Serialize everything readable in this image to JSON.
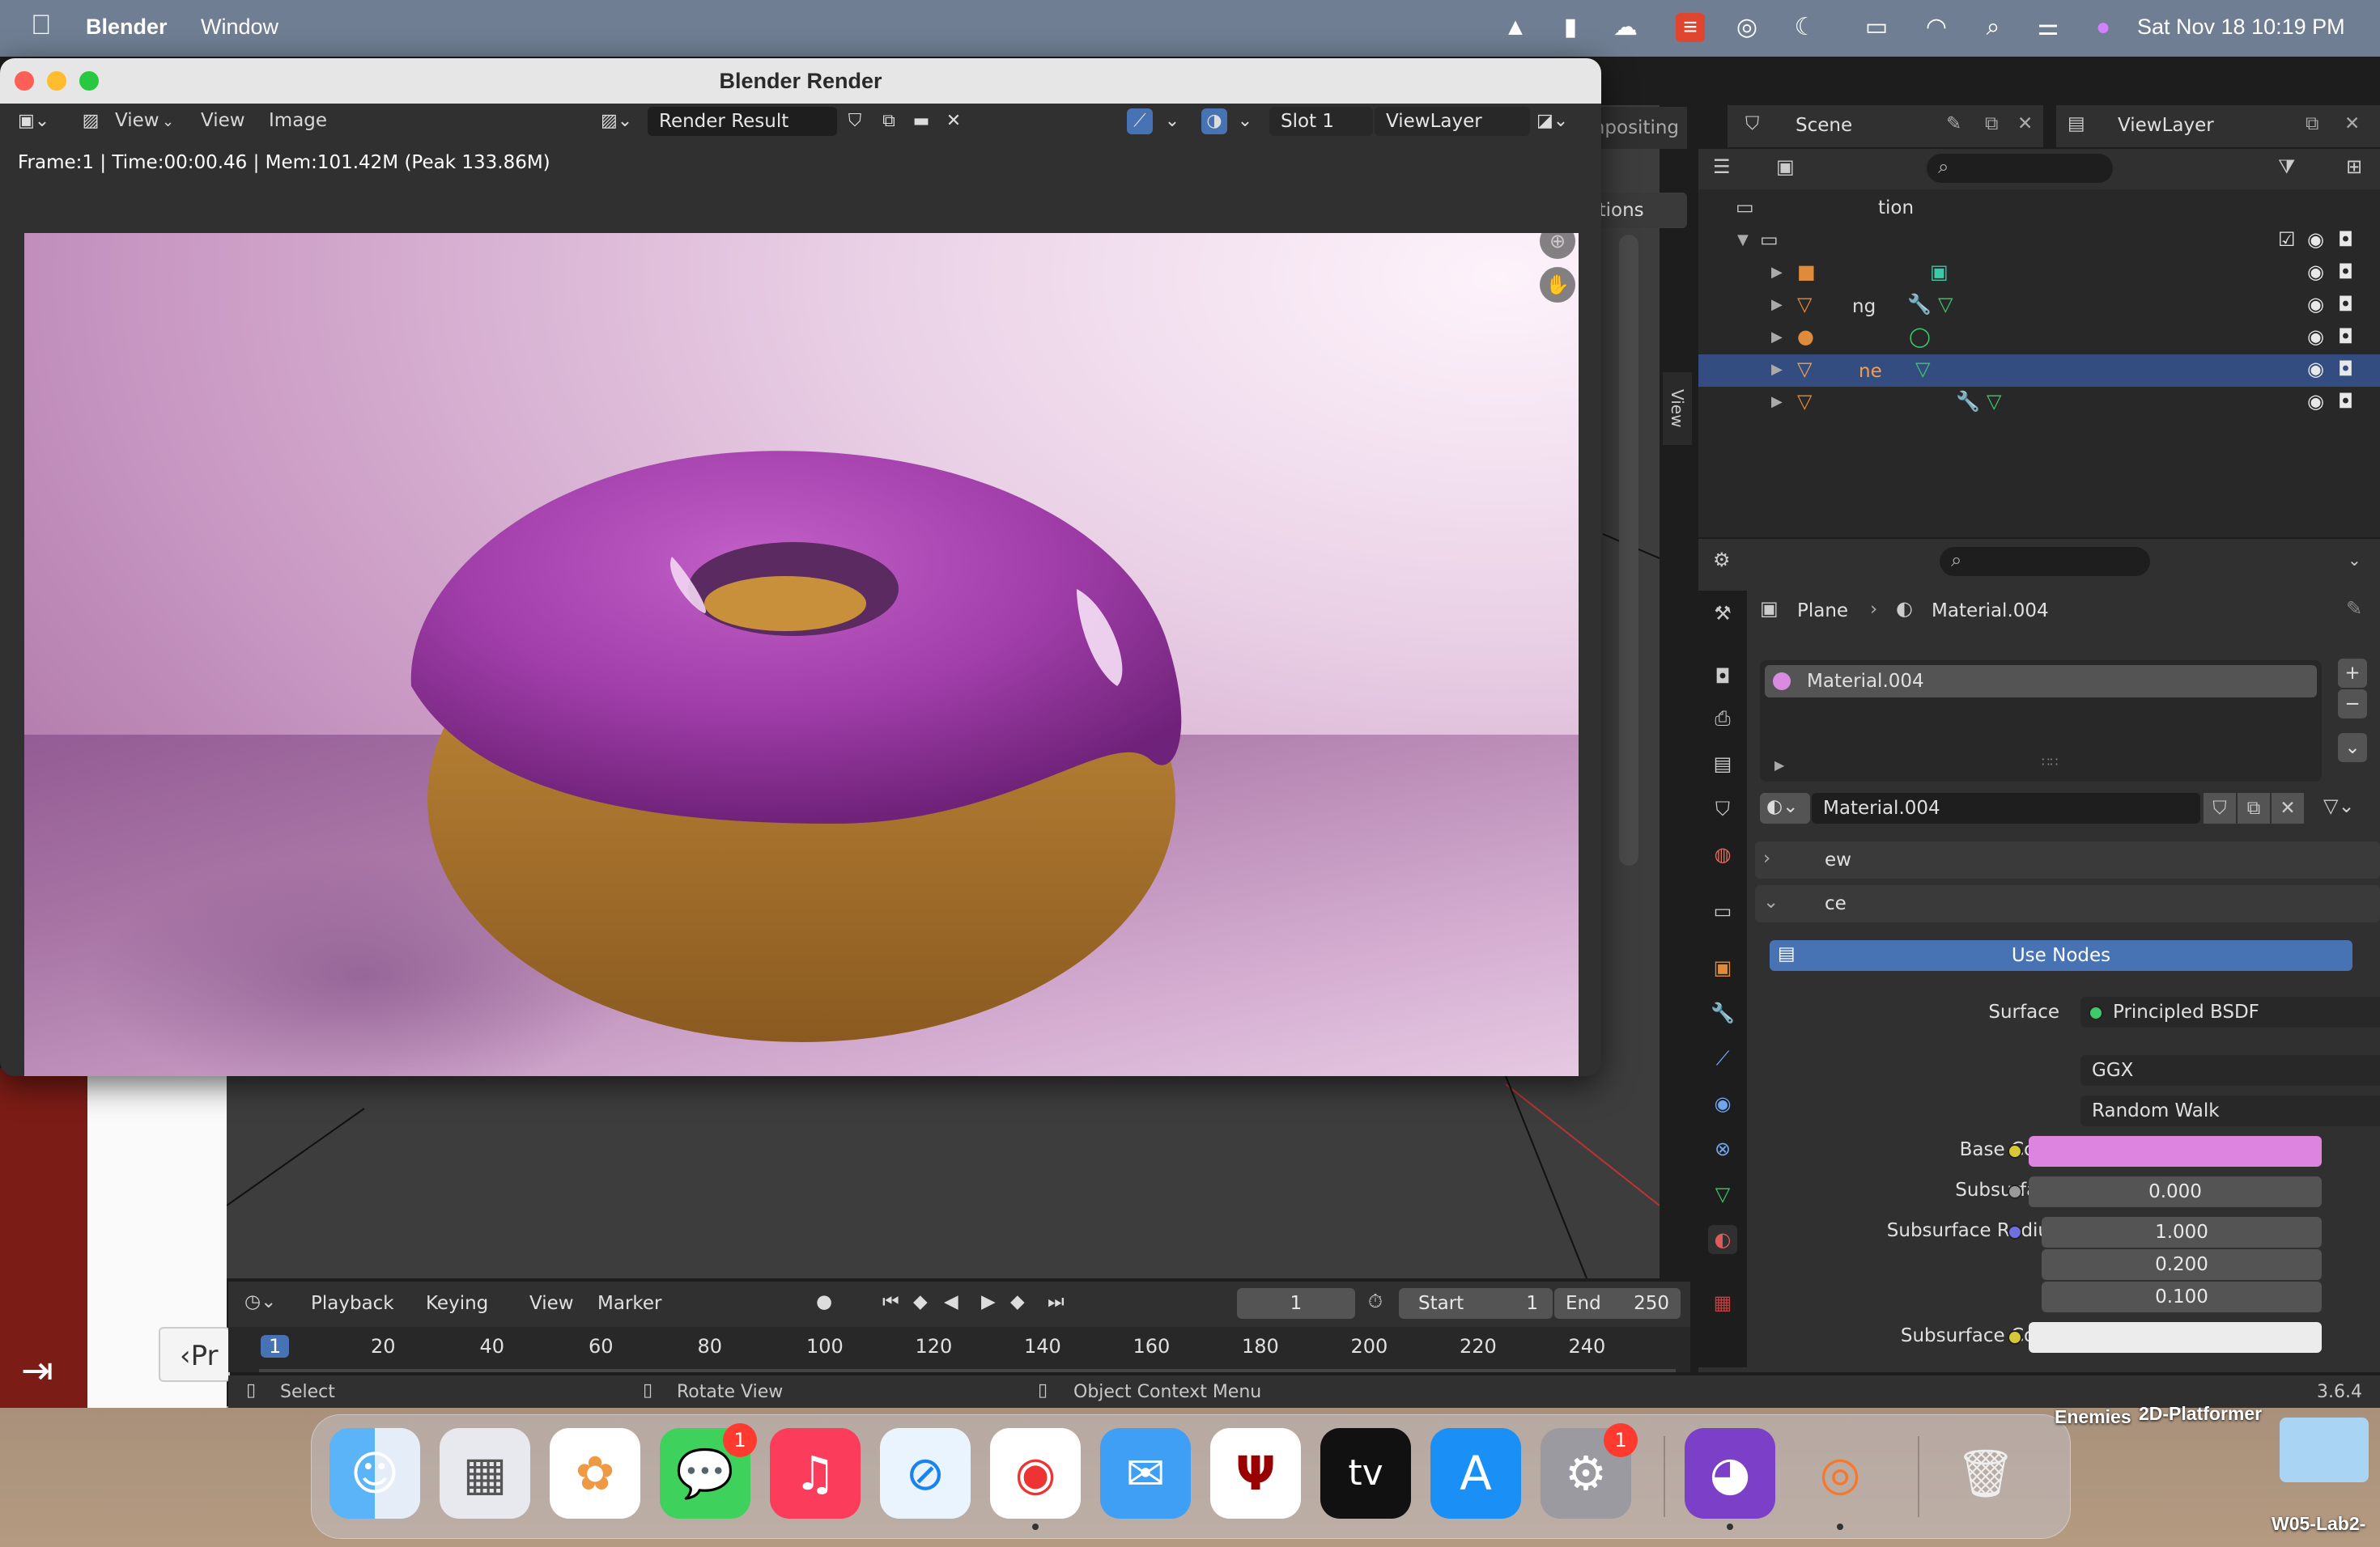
{
  "menubar": {
    "app_name": "Blender",
    "window_menu": "Window",
    "datetime": "Sat Nov 18  10:19 PM"
  },
  "render_window": {
    "title": "Blender Render",
    "toolbar": {
      "view_menu": "View",
      "view_item": "View",
      "image_item": "Image",
      "image_name": "Render Result",
      "slot": "Slot 1",
      "layer": "ViewLayer"
    },
    "info": "Frame:1 | Time:00:00.46 | Mem:101.42M (Peak 133.86M)"
  },
  "behind_window": {
    "compositing_tab": "mpositing",
    "options_btn": "ptions",
    "view_tab": "View"
  },
  "top_right": {
    "scene_label": "Scene",
    "viewlayer_label": "ViewLayer"
  },
  "outliner": {
    "collection_partial": "tion",
    "rows": [
      {
        "name": ""
      },
      {
        "name": "ng"
      },
      {
        "name": ""
      },
      {
        "name": "ne"
      },
      {
        "name": ""
      }
    ]
  },
  "properties": {
    "breadcrumb_object": "Plane",
    "breadcrumb_material": "Material.004",
    "slot_name": "Material.004",
    "material_name": "Material.004",
    "panel_preview": "ew",
    "panel_surface": "ce",
    "use_nodes": "Use Nodes",
    "surface_label": "Surface",
    "surface_value": "Principled BSDF",
    "distribution": "GGX",
    "subsurface_method": "Random Walk",
    "base_color_label": "Base Color",
    "base_color": "#dd84e0",
    "subsurface_label": "Subsurface",
    "subsurface_value": "0.000",
    "subsurface_radius_label": "Subsurface Radius",
    "radius": [
      "1.000",
      "0.200",
      "0.100"
    ],
    "subsurface_color_label": "Subsurface Color",
    "subsurface_color": "#ececec"
  },
  "timeline": {
    "playback": "Playback",
    "keying": "Keying",
    "view": "View",
    "marker": "Marker",
    "current_frame": "1",
    "start_label": "Start",
    "start_value": "1",
    "end_label": "End",
    "end_value": "250",
    "ticks": [
      "1",
      "20",
      "40",
      "60",
      "80",
      "100",
      "120",
      "140",
      "160",
      "180",
      "200",
      "220",
      "240"
    ]
  },
  "statusbar": {
    "select": "Select",
    "rotate": "Rotate View",
    "context": "Object Context Menu",
    "version": "3.6.4"
  },
  "dock": {
    "apps": [
      {
        "name": "finder-icon"
      },
      {
        "name": "launchpad-icon"
      },
      {
        "name": "photos-icon"
      },
      {
        "name": "messages-icon",
        "badge": "1"
      },
      {
        "name": "music-icon"
      },
      {
        "name": "safari-icon"
      },
      {
        "name": "chrome-icon"
      },
      {
        "name": "mail-icon"
      },
      {
        "name": "iu-icon"
      },
      {
        "name": "appletv-icon",
        "label": "tv"
      },
      {
        "name": "appstore-icon"
      },
      {
        "name": "system-settings-icon",
        "badge": "1"
      },
      {
        "name": "github-desktop-icon"
      },
      {
        "name": "blender-icon"
      },
      {
        "name": "trash-icon"
      }
    ]
  },
  "desktop": {
    "label_enemies": "Enemies",
    "label_platformer": "2D-Platformer",
    "label_w05": "W05-Lab2-"
  }
}
